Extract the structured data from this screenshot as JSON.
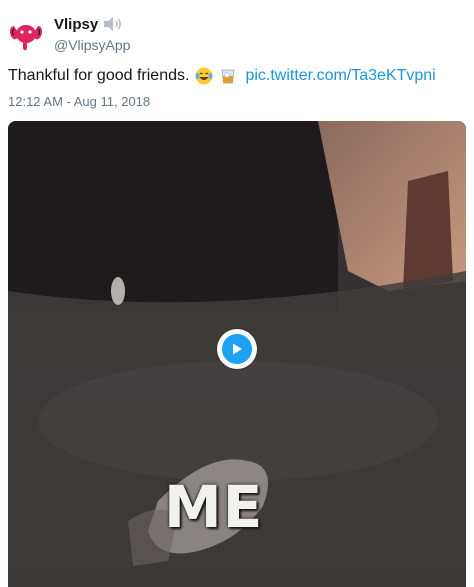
{
  "author": {
    "display_name": "Vlipsy",
    "handle": "@VlipsyApp",
    "avatar_icon": "elephant-logo-icon",
    "badge_icon": "speaker-icon",
    "brand_color": "#e0245e"
  },
  "tweet": {
    "text": "Thankful for good friends.",
    "emojis": [
      "tears-of-joy-emoji",
      "tumbler-glass-emoji"
    ],
    "link": "pic.twitter.com/Ta3eKTvpni",
    "timestamp": "12:12 AM - Aug 11, 2018",
    "link_color": "#1b95e0"
  },
  "media": {
    "caption": "ME",
    "play_icon": "play-icon",
    "accent": "#1da1f2"
  }
}
